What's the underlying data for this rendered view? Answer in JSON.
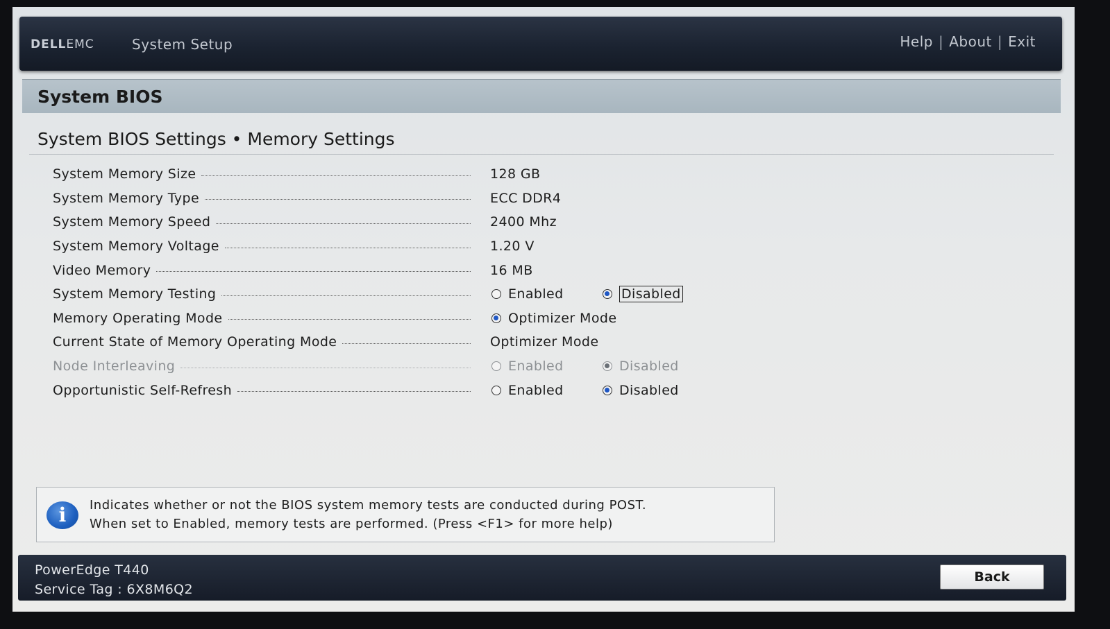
{
  "header": {
    "logo_left": "DELL",
    "logo_right": "EMC",
    "title": "System Setup",
    "links": [
      "Help",
      "About",
      "Exit"
    ],
    "separator": "|"
  },
  "page": {
    "title": "System BIOS",
    "section": "System BIOS Settings • Memory Settings"
  },
  "rows": [
    {
      "label": "System Memory Size",
      "value": "128 GB"
    },
    {
      "label": "System Memory Type",
      "value": "ECC DDR4"
    },
    {
      "label": "System Memory Speed",
      "value": "2400 Mhz"
    },
    {
      "label": "System Memory Voltage",
      "value": "1.20 V"
    },
    {
      "label": "Video Memory",
      "value": "16 MB"
    },
    {
      "label": "System Memory Testing",
      "options": [
        "Enabled",
        "Disabled"
      ],
      "selected": "Disabled",
      "focused": true
    },
    {
      "label": "Memory Operating Mode",
      "options": [
        "Optimizer Mode"
      ],
      "selected": "Optimizer Mode"
    },
    {
      "label": "Current State of Memory Operating Mode",
      "value": "Optimizer Mode"
    },
    {
      "label": "Node Interleaving",
      "options": [
        "Enabled",
        "Disabled"
      ],
      "selected": "Disabled",
      "disabled": true
    },
    {
      "label": "Opportunistic Self-Refresh",
      "options": [
        "Enabled",
        "Disabled"
      ],
      "selected": "Disabled"
    }
  ],
  "info": {
    "line1": "Indicates whether or not the BIOS system memory tests are conducted during POST.",
    "line2": "When set to Enabled, memory tests are performed. (Press <F1> for more help)",
    "icon": "info-icon"
  },
  "footer": {
    "model": "PowerEdge T440",
    "service_tag": "Service Tag : 6X8M6Q2",
    "back_label": "Back"
  }
}
